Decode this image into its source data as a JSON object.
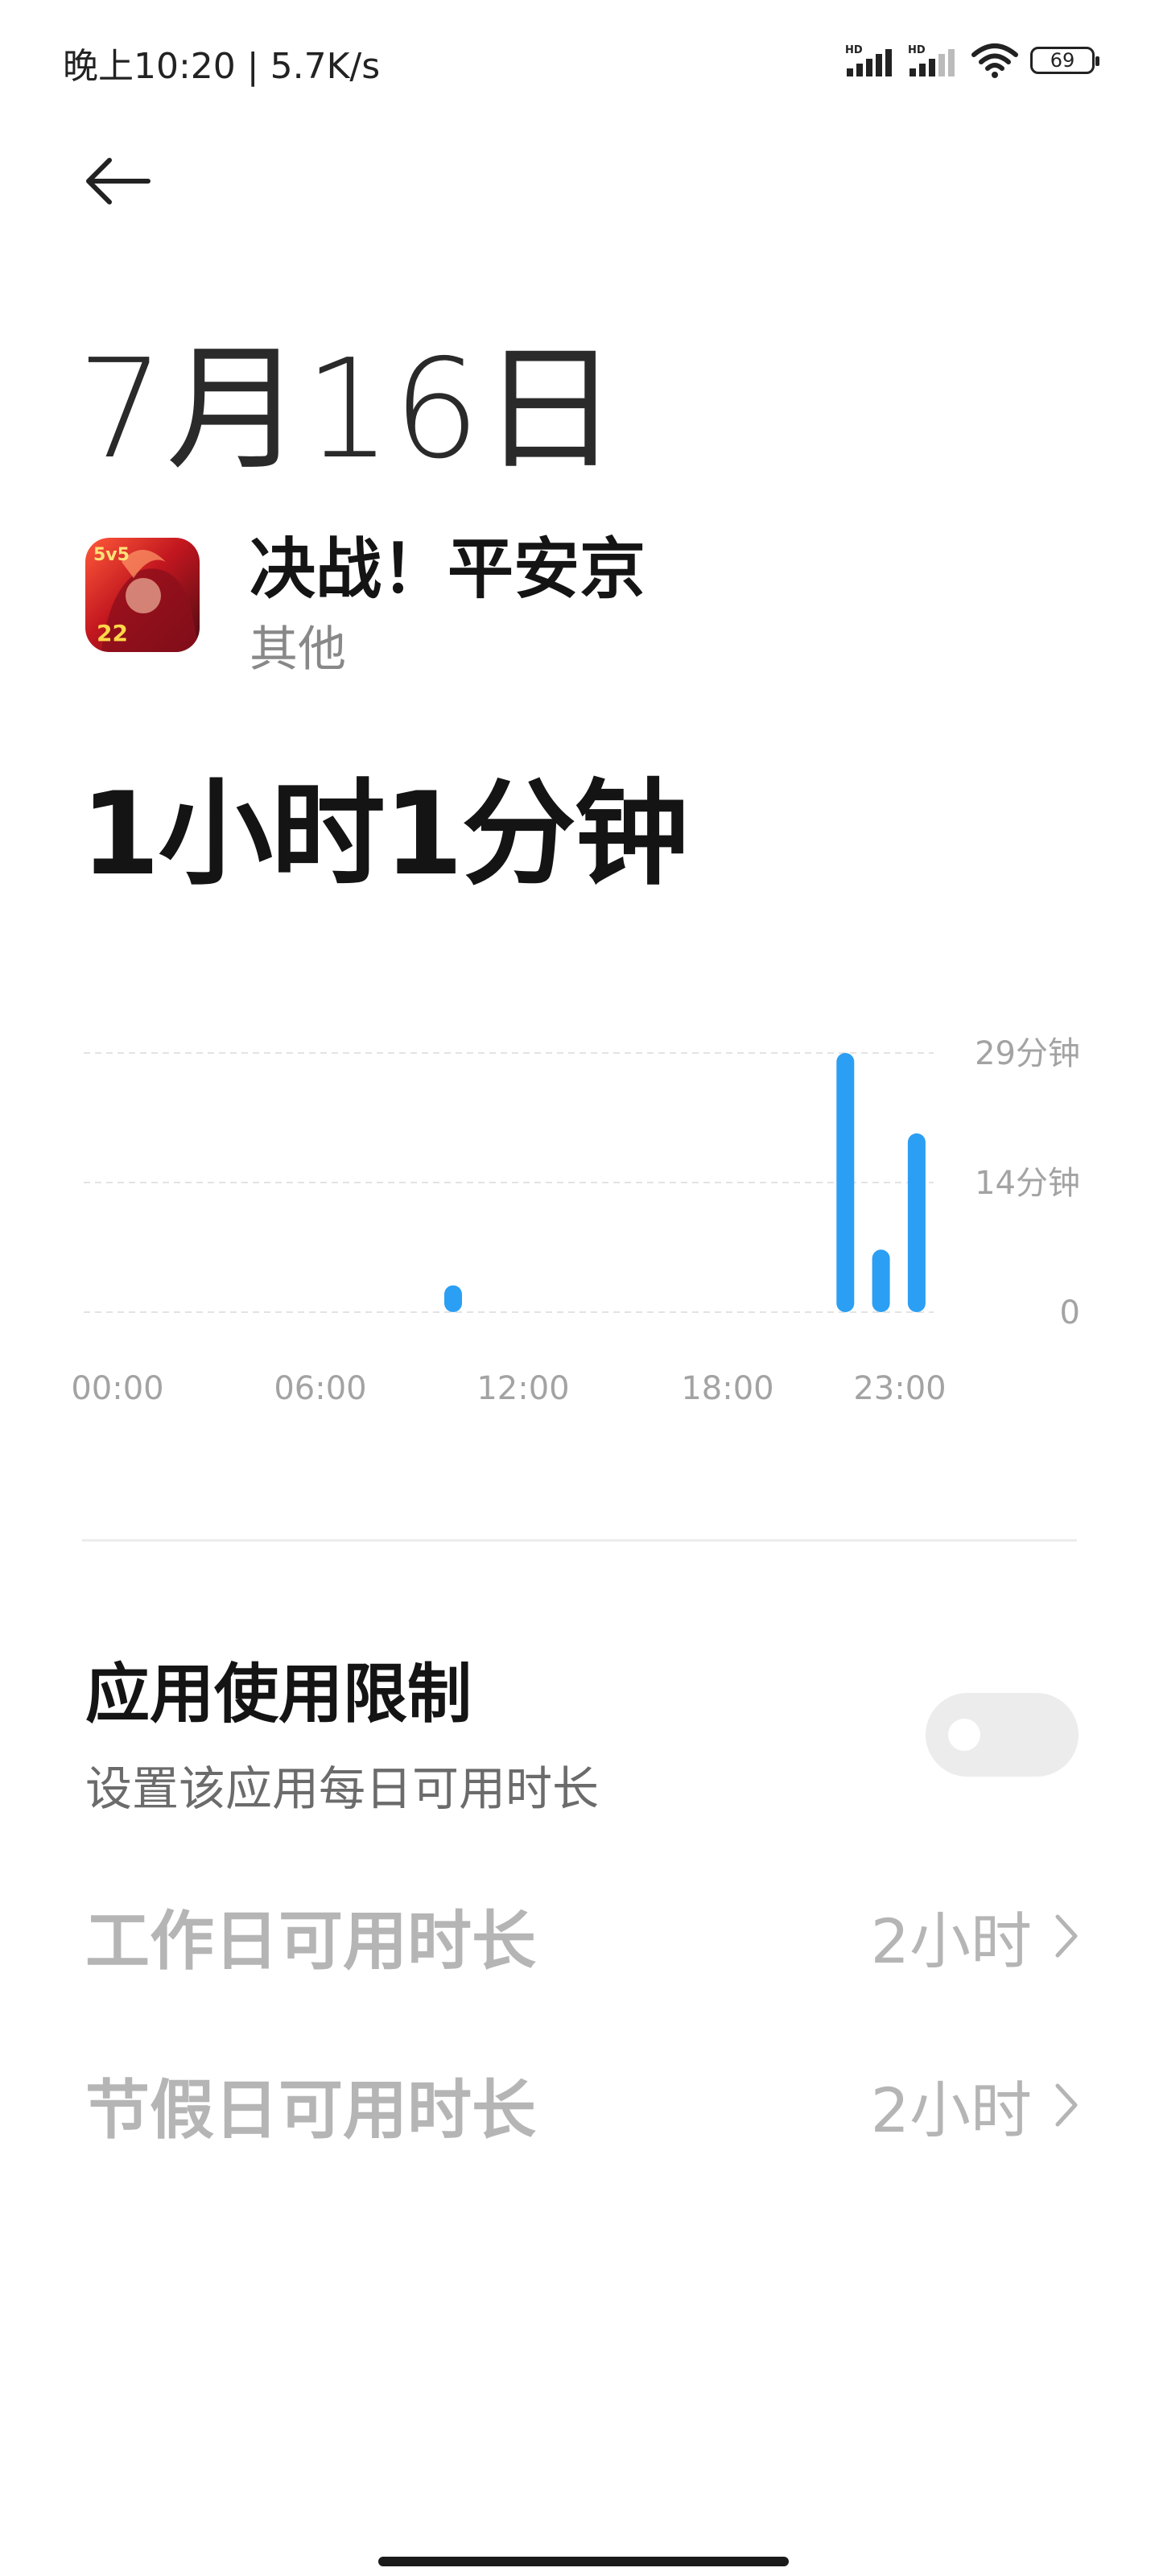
{
  "status_bar": {
    "time": "晚上10:20 | 5.7K/s",
    "battery": "69",
    "icons": [
      "hd-signal-icon",
      "hd-signal-icon",
      "wifi-icon",
      "battery-icon"
    ]
  },
  "header": {
    "back_icon": "back-arrow-icon"
  },
  "date": "7月16日",
  "app": {
    "name": "决战！平安京",
    "category": "其他",
    "icon": "app-icon"
  },
  "total_time": "1小时1分钟",
  "chart_data": {
    "type": "bar",
    "unit": "分钟",
    "x_tick_labels": [
      "00:00",
      "06:00",
      "12:00",
      "18:00",
      "23:00"
    ],
    "y_tick_labels": [
      "29分钟",
      "14分钟",
      "0"
    ],
    "ylim": [
      0,
      29
    ],
    "grid": true,
    "color": "#2b9ff3",
    "bars": [
      {
        "hour": 10,
        "value": 3
      },
      {
        "hour": 21,
        "value": 29
      },
      {
        "hour": 22,
        "value": 7
      },
      {
        "hour": 23,
        "value": 20
      }
    ]
  },
  "limit": {
    "title": "应用使用限制",
    "subtitle": "设置该应用每日可用时长",
    "enabled": false,
    "rows": [
      {
        "label": "工作日可用时长",
        "value": "2小时"
      },
      {
        "label": "节假日可用时长",
        "value": "2小时"
      }
    ]
  }
}
